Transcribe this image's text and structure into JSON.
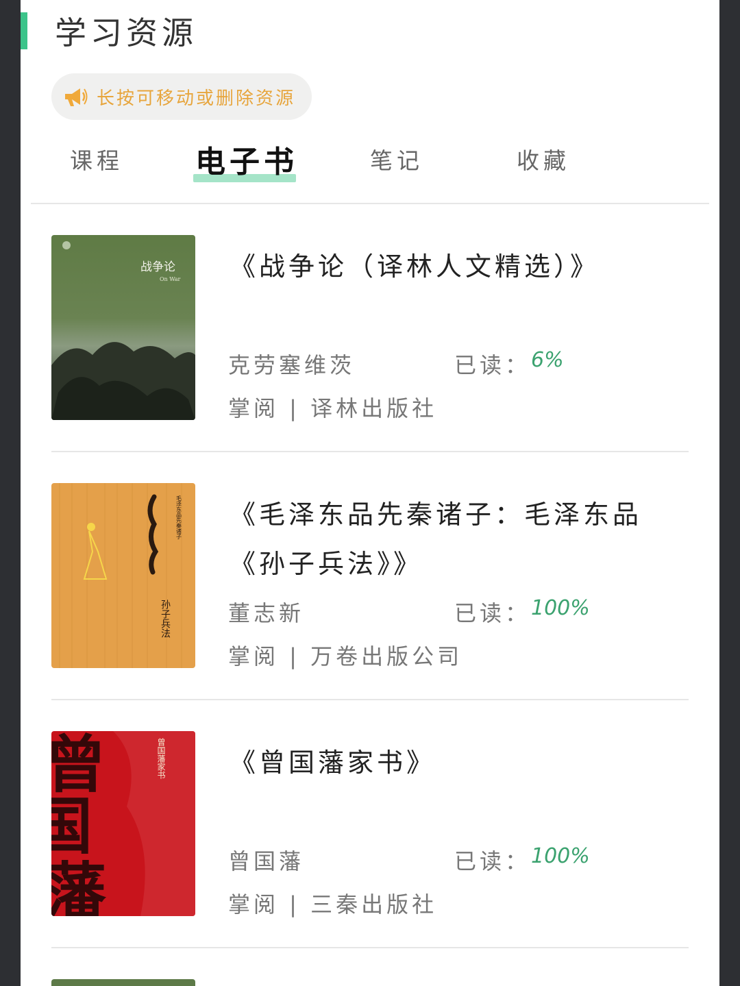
{
  "header": {
    "title": "学习资源"
  },
  "hint": {
    "text": "长按可移动或删除资源",
    "color": "#e7a53c"
  },
  "tabs": [
    {
      "label": "课程"
    },
    {
      "label": "电子书",
      "active": true
    },
    {
      "label": "笔记"
    },
    {
      "label": "收藏"
    }
  ],
  "colors": {
    "accent": "#3cc48a",
    "tab_underline": "#a5e4c8",
    "progress": "#3ba26f"
  },
  "books": [
    {
      "title": "《战争论（译林人文精选）》",
      "author": "克劳塞维茨",
      "read_label": "已读：",
      "read_pct": "6%",
      "publisher": "掌阅 | 译林出版社",
      "cover": {
        "title": "战争论",
        "subtitle": "On War",
        "color": "#5e7a45"
      }
    },
    {
      "title": "《毛泽东品先秦诸子：毛泽东品《孙子兵法》》",
      "author": "董志新",
      "read_label": "已读：",
      "read_pct": "100%",
      "publisher": "掌阅 | 万卷出版公司",
      "cover": {
        "title": "孙子兵法",
        "series": "毛泽东品先秦诸子",
        "color": "#e6a14a"
      }
    },
    {
      "title": "《曾国藩家书》",
      "author": "曾国藩",
      "read_label": "已读：",
      "read_pct": "100%",
      "publisher": "掌阅 | 三秦出版社",
      "cover": {
        "title": "曾国藩家书",
        "big_chars": "曾国藩",
        "color": "#c8141c"
      }
    }
  ]
}
